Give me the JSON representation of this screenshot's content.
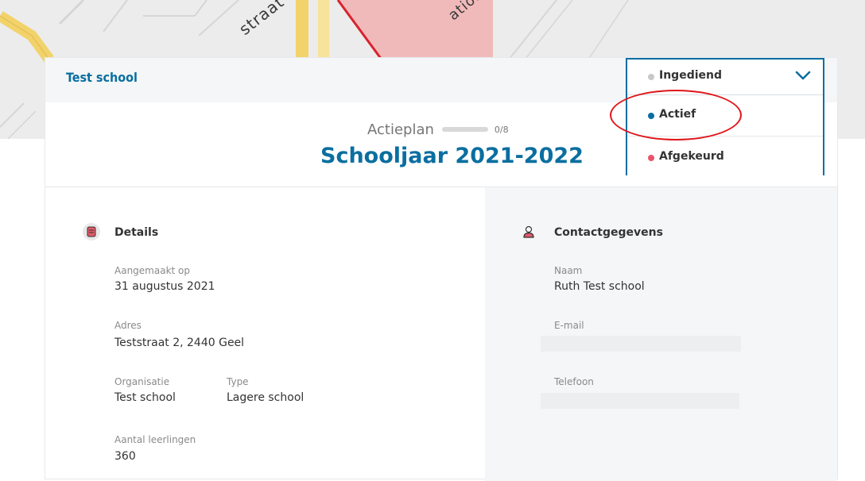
{
  "map": {
    "street_label_1": "straat",
    "street_label_2": "ation"
  },
  "header": {
    "school_name": "Test school"
  },
  "plan": {
    "label": "Actieplan",
    "progress_text": "0/8",
    "progress_fraction": 0,
    "year_title": "Schooljaar 2021-2022"
  },
  "status_dropdown": {
    "selected": {
      "label": "Ingediend",
      "dot_color": "#c8c8c8"
    },
    "options": [
      {
        "label": "Actief",
        "dot_color": "#0a6ea0"
      },
      {
        "label": "Afgekeurd",
        "dot_color": "#e8556b"
      }
    ],
    "chevron_icon": "chevron-down-icon"
  },
  "details": {
    "title": "Details",
    "icon": "building-icon",
    "created_label": "Aangemaakt op",
    "created_value": "31 augustus 2021",
    "address_label": "Adres",
    "address_value": "Teststraat 2, 2440 Geel",
    "organisation_label": "Organisatie",
    "organisation_value": "Test school",
    "type_label": "Type",
    "type_value": "Lagere school",
    "students_label": "Aantal leerlingen",
    "students_value": "360"
  },
  "contact": {
    "title": "Contactgegevens",
    "icon": "user-icon",
    "name_label": "Naam",
    "name_value": "Ruth Test school",
    "email_label": "E-mail",
    "phone_label": "Telefoon"
  },
  "colors": {
    "accent": "#0a6ea0",
    "annotation": "#e0161a"
  }
}
